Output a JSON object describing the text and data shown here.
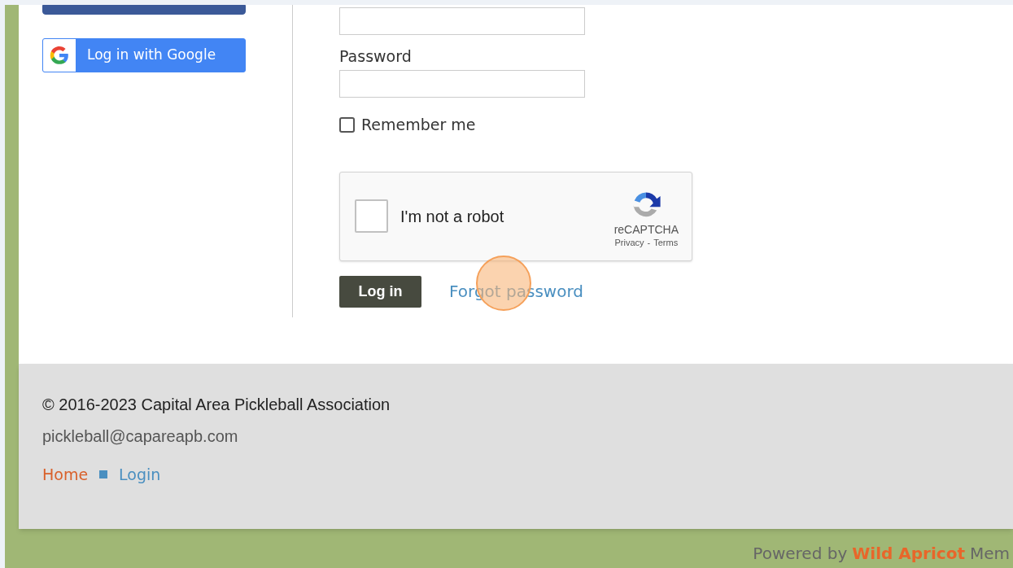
{
  "social_login": {
    "google_button": "Log in with Google"
  },
  "form": {
    "password_label": "Password",
    "remember_me": {
      "label": "Remember me",
      "checked": false
    },
    "captcha": {
      "label": "I'm not a robot",
      "checked": false,
      "brand": "reCAPTCHA",
      "privacy": "Privacy",
      "separator": "-",
      "terms": "Terms"
    },
    "login_button": "Log in",
    "forgot_link": "Forgot password"
  },
  "footer": {
    "copyright": "© 2016-2023 Capital Area Pickleball Association",
    "email": "pickleball@capareapb.com",
    "links": [
      {
        "label": "Home",
        "selected": true
      },
      {
        "label": "Login",
        "selected": false
      }
    ]
  },
  "powered_by": {
    "text": "Powered by",
    "brand": "Wild Apricot",
    "rest": "Mem"
  }
}
